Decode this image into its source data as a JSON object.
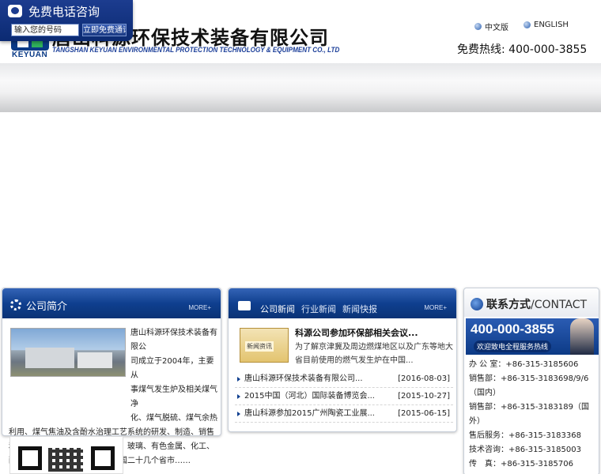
{
  "call_widget": {
    "title": "免费电话咨询",
    "input_value": "输入您的号码",
    "button_label": "立即免费通话"
  },
  "header": {
    "company_cn": "唐山科源环保技术装备有限公司",
    "company_en": "TANGSHAN KEYUAN ENVIRONMENTAL PROTECTION TECHNOLOGY & EQUIPMENT CO., LTD",
    "logo_text": "KEYUAN",
    "lang_cn": "中文版",
    "lang_en": "ENGLISH",
    "hotline": "免费热线: 400-000-3855"
  },
  "about": {
    "title": "公司简介",
    "more": "MORE+",
    "text_lines": [
      "唐山科源环保技术装备有限公",
      "司成立于2004年，主要从",
      "事煤气发生炉及相关煤气净",
      "化、煤气脱硫、煤气余热"
    ],
    "text_rest": "利用、煤气焦油及含酚水治理工艺系统的研发、制造、销售和服务，广泛服务于冶金、陶瓷、玻璃、有色金属、化工、耐材、机械等行业，产品遍布全国二十几个省市……"
  },
  "news": {
    "tabs": [
      "公司新闻",
      "行业新闻",
      "新闻快报"
    ],
    "more": "MORE+",
    "feature_image_label": "新闻资讯",
    "feature_title": "科源公司参加环保部相关会议...",
    "feature_text": "为了解京津冀及周边燃煤地区以及广东等地大省目前使用的燃气发生炉在中国...",
    "items": [
      {
        "title": "唐山科源环保技术装备有限公司...",
        "date": "[2016-08-03]"
      },
      {
        "title": "2015中国（河北）国际装备博览会...",
        "date": "[2015-10-27]"
      },
      {
        "title": "唐山科源参加2015广州陶瓷工业展...",
        "date": "[2015-06-15]"
      }
    ]
  },
  "contact": {
    "title_cn": "联系方式",
    "title_en": "/CONTACT",
    "banner_number": "400-000-3855",
    "banner_sub": "欢迎致电全程服务热线",
    "lines": [
      "办 公 室：+86-315-3185606",
      "销售部：+86-315-3183698/9/6（国内）",
      "销售部：+86-315-3183189（国外）",
      "售后服务：+86-315-3183368",
      "技术咨询：+86-315-3185003",
      "传　真：+86-315-3185706"
    ]
  }
}
